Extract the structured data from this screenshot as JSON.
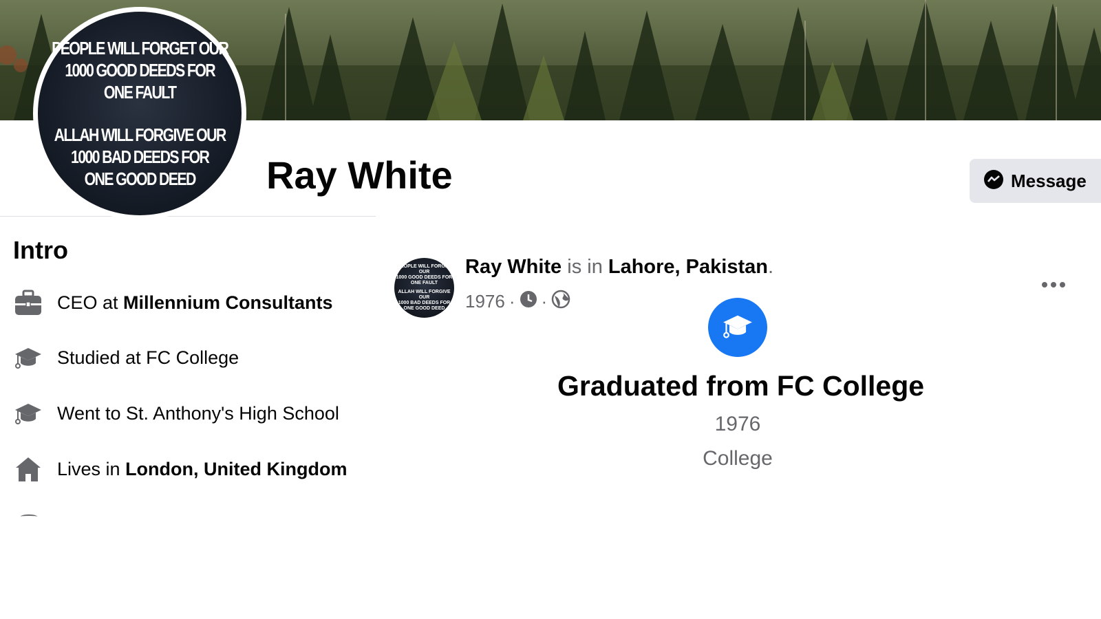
{
  "profile": {
    "name": "Ray White",
    "picture_quote": {
      "part1": [
        "PEOPLE WILL FORGET OUR",
        "1000 GOOD DEEDS FOR",
        "ONE FAULT"
      ],
      "part2": [
        "ALLAH WILL FORGIVE OUR",
        "1000 BAD DEEDS FOR",
        "ONE GOOD DEED"
      ]
    }
  },
  "actions": {
    "message_label": "Message",
    "message_icon": "messenger-icon"
  },
  "intro": {
    "title": "Intro",
    "items": [
      {
        "icon": "briefcase-icon",
        "prefix": "CEO at ",
        "bold": "Millennium Consultants"
      },
      {
        "icon": "graduation-cap-icon",
        "prefix": "Studied at FC College",
        "bold": ""
      },
      {
        "icon": "graduation-cap-icon",
        "prefix": "Went to St. Anthony's High School",
        "bold": ""
      },
      {
        "icon": "home-icon",
        "prefix": "Lives in ",
        "bold": "London, United Kingdom"
      }
    ]
  },
  "post": {
    "author": "Ray White",
    "connector": " is in ",
    "location": "Lahore, Pakistan",
    "period": ".",
    "year": "1976",
    "sep": "·",
    "meta_icons": [
      "clock-icon",
      "globe-icon"
    ],
    "event": {
      "icon": "graduation-cap-icon",
      "title": "Graduated from FC College",
      "year": "1976",
      "type": "College"
    }
  },
  "colors": {
    "accent": "#1877f2",
    "secondary_text": "#65676b",
    "button_bg": "#e4e6eb"
  }
}
